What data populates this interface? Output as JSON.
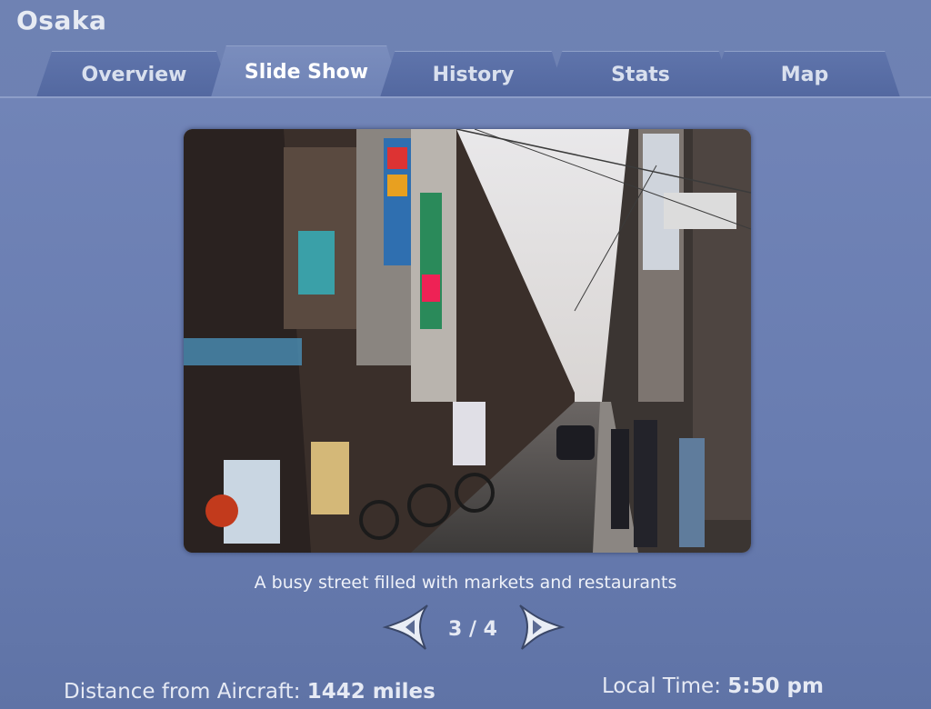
{
  "window": {
    "title": "Osaka"
  },
  "tabs": [
    {
      "label": "Overview",
      "active": false
    },
    {
      "label": "Slide Show",
      "active": true
    },
    {
      "label": "History",
      "active": false
    },
    {
      "label": "Stats",
      "active": false
    },
    {
      "label": "Map",
      "active": false
    }
  ],
  "slideshow": {
    "caption": "A busy street filled with markets and restaurants",
    "counter": "3 / 4",
    "prev_icon": "arrow-left-icon",
    "next_icon": "arrow-right-icon"
  },
  "footer": {
    "distance_label": "Distance from Aircraft:",
    "distance_value": "1442 miles",
    "time_label": "Local Time:",
    "time_value": "5:50 pm"
  },
  "colors": {
    "background": "#6b7fb2",
    "tab_inactive": "#5368a0",
    "tab_active": "#7a8dbd"
  }
}
